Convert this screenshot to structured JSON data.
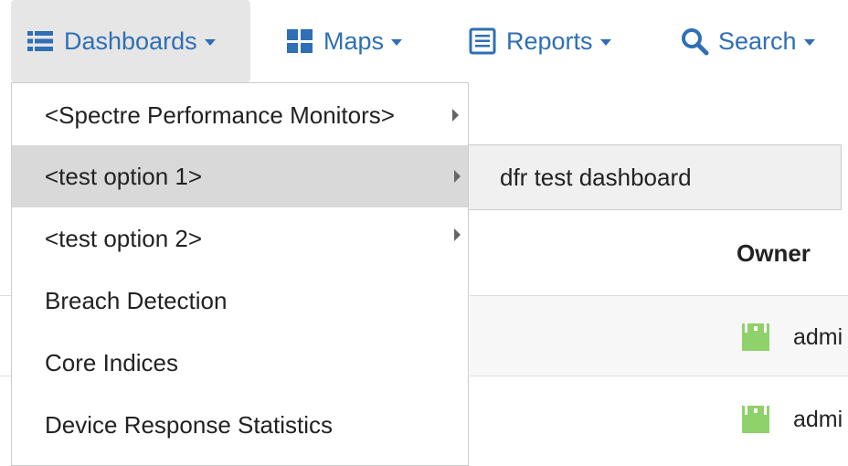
{
  "nav": {
    "dashboards": {
      "label": "Dashboards",
      "icon": "list-icon"
    },
    "maps": {
      "label": "Maps",
      "icon": "grid-icon"
    },
    "reports": {
      "label": "Reports",
      "icon": "document-icon"
    },
    "search": {
      "label": "Search",
      "icon": "search-icon"
    }
  },
  "dashboards_menu": {
    "items": [
      {
        "label": "<Spectre Performance Monitors>",
        "has_submenu": true
      },
      {
        "label": "<test option 1>",
        "has_submenu": true,
        "active": true
      },
      {
        "label": "<test option 2>",
        "has_submenu": true
      },
      {
        "label": "Breach Detection",
        "has_submenu": false
      },
      {
        "label": "Core Indices",
        "has_submenu": false
      },
      {
        "label": "Device Response Statistics",
        "has_submenu": false
      }
    ],
    "submenu": {
      "items": [
        {
          "label": "dfr test dashboard"
        }
      ]
    }
  },
  "table": {
    "owner_header": "Owner",
    "rows": [
      {
        "owner": "admi",
        "icon": "user-icon"
      },
      {
        "owner": "admi",
        "icon": "user-icon"
      }
    ]
  },
  "colors": {
    "link": "#2f6fb5",
    "active_bg": "#d9d9d9",
    "user_icon": "#8fd16a"
  }
}
